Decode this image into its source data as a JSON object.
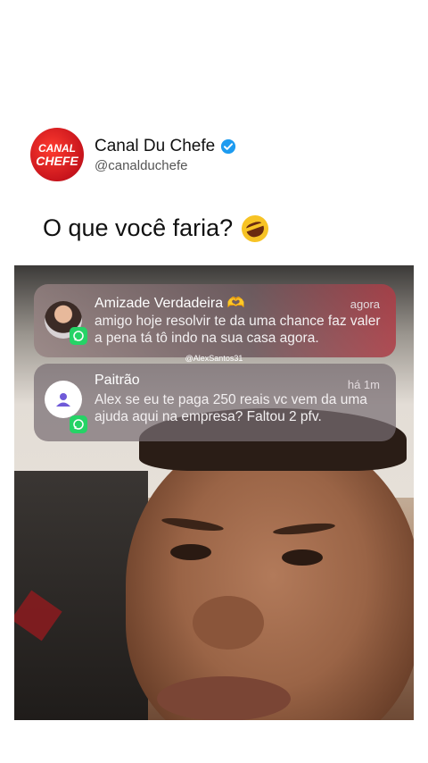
{
  "profile": {
    "name": "Canal Du Chefe",
    "handle": "@canalduchefe",
    "logo_text": "CANAL CHEFE",
    "verified_icon": "verified-badge-icon"
  },
  "post": {
    "question": "O que você faria?",
    "emoji": "rolling-on-the-floor-laughing-emoji"
  },
  "video": {
    "watermark": "@AlexSantos31",
    "notifications": [
      {
        "title": "Amizade Verdadeira 🫶",
        "time": "agora",
        "text": "amigo hoje resolvir te da uma chance faz valer a pena tá tô indo na sua casa agora.",
        "app_icon": "whatsapp-icon"
      },
      {
        "title": "Paitrão",
        "time": "há 1m",
        "text": "Alex se eu te paga 250 reais vc vem da uma ajuda aqui na empresa? Faltou 2 pfv.",
        "app_icon": "whatsapp-icon"
      }
    ]
  },
  "colors": {
    "logo_red": "#d81b22",
    "verified_blue": "#1d9bf0",
    "whatsapp_green": "#25d366"
  }
}
